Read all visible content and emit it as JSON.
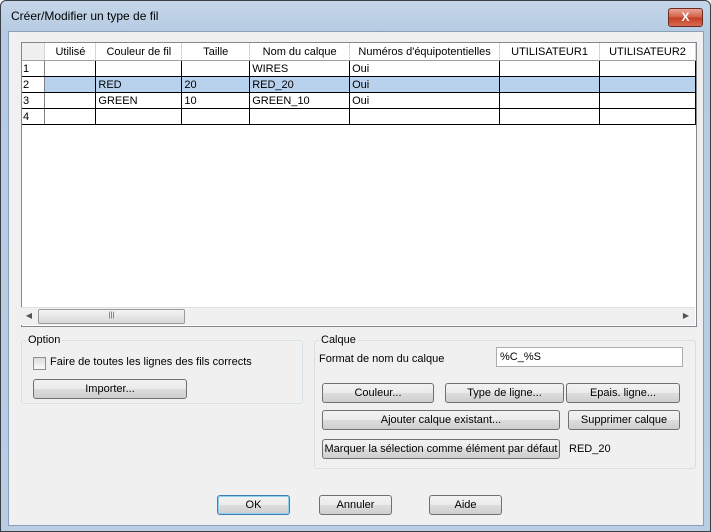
{
  "window": {
    "title": "Créer/Modifier un type de fil",
    "close_label": "X"
  },
  "grid": {
    "headers": [
      "",
      "Utilisé",
      "Couleur de fil",
      "Taille",
      "Nom du calque",
      "Numéros d'équipotentielles",
      "UTILISATEUR1",
      "UTILISATEUR2"
    ],
    "rows": [
      {
        "num": "1",
        "used": "",
        "color": "",
        "size": "",
        "layer": "WIRES",
        "equip": "Oui",
        "u1": "",
        "u2": ""
      },
      {
        "num": "2",
        "used": "",
        "color": "RED",
        "size": "20",
        "layer": "RED_20",
        "equip": "Oui",
        "u1": "",
        "u2": ""
      },
      {
        "num": "3",
        "used": "",
        "color": "GREEN",
        "size": "10",
        "layer": "GREEN_10",
        "equip": "Oui",
        "u1": "",
        "u2": ""
      },
      {
        "num": "4",
        "used": "",
        "color": "",
        "size": "",
        "layer": "",
        "equip": "",
        "u1": "",
        "u2": ""
      }
    ],
    "selected_row": 2
  },
  "option": {
    "legend": "Option",
    "checkbox_label": "Faire de toutes les lignes des fils corrects",
    "checkbox_checked": false,
    "import_button": "Importer..."
  },
  "calque": {
    "legend": "Calque",
    "format_label": "Format de nom du calque",
    "format_value": "%C_%S",
    "couleur_button": "Couleur...",
    "type_ligne_button": "Type de ligne...",
    "epais_button": "Epais. ligne...",
    "ajouter_button": "Ajouter calque existant...",
    "supprimer_button": "Supprimer calque",
    "marquer_button": "Marquer la sélection comme élément par défaut",
    "default_value": "RED_20"
  },
  "footer": {
    "ok": "OK",
    "cancel": "Annuler",
    "help": "Aide"
  }
}
